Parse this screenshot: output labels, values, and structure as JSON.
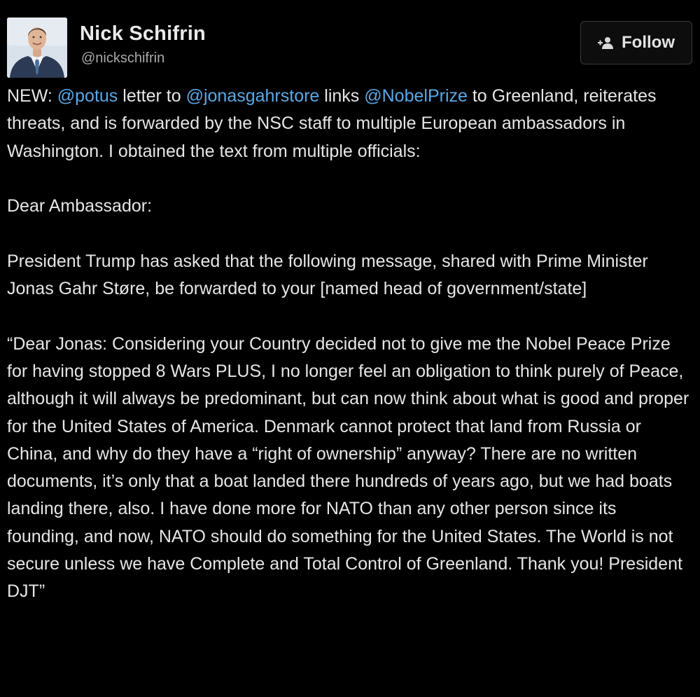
{
  "author": {
    "name": "Nick Schifrin",
    "handle": "@nickschifrin",
    "avatar_icon": "person-portrait"
  },
  "follow_button": {
    "label": "Follow",
    "icon": "add-user-icon"
  },
  "colors": {
    "background": "#000000",
    "text": "#e6e6e6",
    "mention": "#5aa8e6",
    "secondary_text": "#a9a9a9"
  },
  "intro": {
    "lead": "NEW: ",
    "mention1": "@potus",
    "text1": " letter to ",
    "mention2": "@jonasgahrstore",
    "text2": " links ",
    "mention3": "@NobelPrize",
    "text3": " to Greenland, reiterates threats, and is forwarded by the NSC staff to multiple European ambassadors in Washington. I obtained the text from multiple officials:"
  },
  "salutation": "Dear Ambassador:",
  "paragraph2": "President Trump has asked that the following message, shared with Prime Minister Jonas Gahr Støre, be forwarded to your [named head of government/state]",
  "letter": "“Dear Jonas: Considering your Country decided not to give me the Nobel Peace Prize for having stopped 8 Wars PLUS, I no longer feel an obligation to think purely of Peace, although it will always be predominant, but can now think about what is good and proper for the United States of America. Denmark cannot protect that land from Russia or China, and why do they have a “right of ownership” anyway? There are no written documents, it’s only that a boat landed there hundreds of years ago, but we had boats landing there, also. I have done more for NATO than any other person since its founding, and now, NATO should do something for the United States. The World is not secure unless we have Complete and Total Control of Greenland. Thank you! President",
  "signature": "DJT”"
}
